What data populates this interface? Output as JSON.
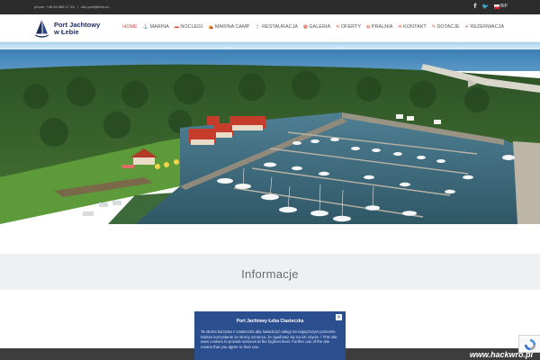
{
  "topbar": {
    "phone": "phone: +48 59 866 17 33",
    "email": "info.port@leba.eu",
    "separator": "|",
    "social": [
      "facebook-icon",
      "twitter-icon"
    ],
    "bip_label": "BIP"
  },
  "header": {
    "logo_line1": "Port Jachtowy",
    "logo_line2": "w Łebie"
  },
  "nav": [
    {
      "label": "HOME",
      "icon": "",
      "active": true
    },
    {
      "label": "MARINA",
      "icon": "⚓"
    },
    {
      "label": "NOCLEGI",
      "icon": "▬"
    },
    {
      "label": "MARINA CAMP",
      "icon": "⛺"
    },
    {
      "label": "RESTAURACJA",
      "icon": "🍴"
    },
    {
      "label": "GALERIA",
      "icon": "▦"
    },
    {
      "label": "OFERTY",
      "icon": "✕"
    },
    {
      "label": "PRALNIA",
      "icon": "◍"
    },
    {
      "label": "KONTAKT",
      "icon": "✉"
    },
    {
      "label": "DOTACJE",
      "icon": "✎"
    },
    {
      "label": "REZERWACJA",
      "icon": "✔"
    }
  ],
  "section": {
    "title": "Informacje"
  },
  "cookie": {
    "title": "Port Jachtowy Łeba Ciasteczka",
    "body": "Ta strona korzysta z ciasteczek aby świadczyć usługi na najwyższym poziomie. Dalsze korzystanie ze strony oznacza, że zgadzasz się na ich użycie. / This site uses cookies to provide services at the highest level. Further use of the site means that you agree to their use.",
    "close": "×"
  },
  "watermark": "www.hackwro.pl",
  "colors": {
    "accent": "#d64b3b",
    "navy": "#1f2b5c",
    "cookie_bg": "#2a4e8e",
    "topbar_bg": "#2c2c2c"
  }
}
